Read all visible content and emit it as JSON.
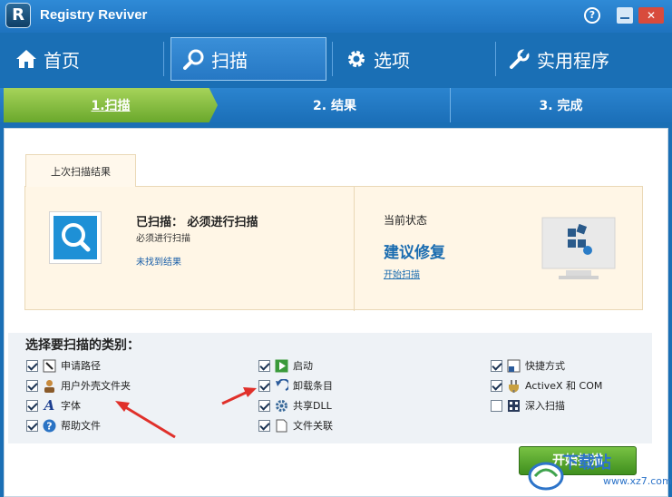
{
  "window": {
    "logo_letter": "R",
    "title": "Registry Reviver",
    "help_symbol": "?",
    "close_symbol": "✕"
  },
  "nav": {
    "tabs": [
      {
        "label": "首页",
        "icon": "home-icon"
      },
      {
        "label": "扫描",
        "icon": "magnifier-icon",
        "active": true
      },
      {
        "label": "选项",
        "icon": "gear-icon"
      },
      {
        "label": "实用程序",
        "icon": "wrench-icon"
      }
    ]
  },
  "steps": [
    {
      "label": "1.扫描",
      "active": true
    },
    {
      "label": "2. 结果"
    },
    {
      "label": "3. 完成"
    }
  ],
  "last_scan": {
    "tab_label": "上次扫描结果",
    "scanned_label": "已扫描： 必须进行扫描",
    "scanned_sub": "必须进行扫描",
    "no_results_link": "未找到结果",
    "status_label": "当前状态",
    "status_value": "建议修复",
    "start_scan_link": "开始扫描"
  },
  "categories": {
    "title": "选择要扫描的类别：",
    "items": [
      {
        "label": "申请路径",
        "checked": true,
        "icon": "app-path-icon"
      },
      {
        "label": "用户外壳文件夹",
        "checked": true,
        "icon": "user-folder-icon"
      },
      {
        "label": "字体",
        "checked": true,
        "icon": "font-icon"
      },
      {
        "label": "帮助文件",
        "checked": true,
        "icon": "help-file-icon"
      },
      {
        "label": "启动",
        "checked": true,
        "icon": "startup-icon"
      },
      {
        "label": "卸载条目",
        "checked": true,
        "icon": "uninstall-icon"
      },
      {
        "label": "共享DLL",
        "checked": true,
        "icon": "shared-dll-icon"
      },
      {
        "label": "文件关联",
        "checked": true,
        "icon": "file-association-icon"
      },
      {
        "label": "快捷方式",
        "checked": true,
        "icon": "shortcut-icon"
      },
      {
        "label": "ActiveX 和 COM",
        "checked": true,
        "icon": "activex-icon"
      },
      {
        "label": "深入扫描",
        "checked": false,
        "icon": "deep-scan-icon"
      }
    ]
  },
  "start_button_label": "开始扫描",
  "watermark": {
    "text": "下载站",
    "url": "www.xz7.com"
  },
  "colors": {
    "accent": "#1a6fb5",
    "green": "#5aa02c",
    "link": "#1a6cb0"
  }
}
